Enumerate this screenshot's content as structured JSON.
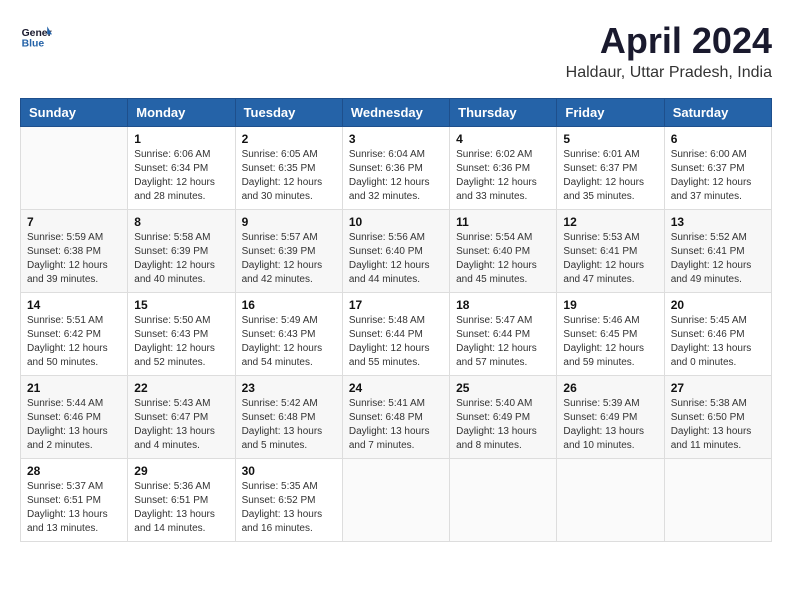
{
  "logo": {
    "line1": "General",
    "line2": "Blue"
  },
  "title": "April 2024",
  "location": "Haldaur, Uttar Pradesh, India",
  "headers": [
    "Sunday",
    "Monday",
    "Tuesday",
    "Wednesday",
    "Thursday",
    "Friday",
    "Saturday"
  ],
  "weeks": [
    [
      {
        "day": "",
        "info": ""
      },
      {
        "day": "1",
        "info": "Sunrise: 6:06 AM\nSunset: 6:34 PM\nDaylight: 12 hours\nand 28 minutes."
      },
      {
        "day": "2",
        "info": "Sunrise: 6:05 AM\nSunset: 6:35 PM\nDaylight: 12 hours\nand 30 minutes."
      },
      {
        "day": "3",
        "info": "Sunrise: 6:04 AM\nSunset: 6:36 PM\nDaylight: 12 hours\nand 32 minutes."
      },
      {
        "day": "4",
        "info": "Sunrise: 6:02 AM\nSunset: 6:36 PM\nDaylight: 12 hours\nand 33 minutes."
      },
      {
        "day": "5",
        "info": "Sunrise: 6:01 AM\nSunset: 6:37 PM\nDaylight: 12 hours\nand 35 minutes."
      },
      {
        "day": "6",
        "info": "Sunrise: 6:00 AM\nSunset: 6:37 PM\nDaylight: 12 hours\nand 37 minutes."
      }
    ],
    [
      {
        "day": "7",
        "info": "Sunrise: 5:59 AM\nSunset: 6:38 PM\nDaylight: 12 hours\nand 39 minutes."
      },
      {
        "day": "8",
        "info": "Sunrise: 5:58 AM\nSunset: 6:39 PM\nDaylight: 12 hours\nand 40 minutes."
      },
      {
        "day": "9",
        "info": "Sunrise: 5:57 AM\nSunset: 6:39 PM\nDaylight: 12 hours\nand 42 minutes."
      },
      {
        "day": "10",
        "info": "Sunrise: 5:56 AM\nSunset: 6:40 PM\nDaylight: 12 hours\nand 44 minutes."
      },
      {
        "day": "11",
        "info": "Sunrise: 5:54 AM\nSunset: 6:40 PM\nDaylight: 12 hours\nand 45 minutes."
      },
      {
        "day": "12",
        "info": "Sunrise: 5:53 AM\nSunset: 6:41 PM\nDaylight: 12 hours\nand 47 minutes."
      },
      {
        "day": "13",
        "info": "Sunrise: 5:52 AM\nSunset: 6:41 PM\nDaylight: 12 hours\nand 49 minutes."
      }
    ],
    [
      {
        "day": "14",
        "info": "Sunrise: 5:51 AM\nSunset: 6:42 PM\nDaylight: 12 hours\nand 50 minutes."
      },
      {
        "day": "15",
        "info": "Sunrise: 5:50 AM\nSunset: 6:43 PM\nDaylight: 12 hours\nand 52 minutes."
      },
      {
        "day": "16",
        "info": "Sunrise: 5:49 AM\nSunset: 6:43 PM\nDaylight: 12 hours\nand 54 minutes."
      },
      {
        "day": "17",
        "info": "Sunrise: 5:48 AM\nSunset: 6:44 PM\nDaylight: 12 hours\nand 55 minutes."
      },
      {
        "day": "18",
        "info": "Sunrise: 5:47 AM\nSunset: 6:44 PM\nDaylight: 12 hours\nand 57 minutes."
      },
      {
        "day": "19",
        "info": "Sunrise: 5:46 AM\nSunset: 6:45 PM\nDaylight: 12 hours\nand 59 minutes."
      },
      {
        "day": "20",
        "info": "Sunrise: 5:45 AM\nSunset: 6:46 PM\nDaylight: 13 hours\nand 0 minutes."
      }
    ],
    [
      {
        "day": "21",
        "info": "Sunrise: 5:44 AM\nSunset: 6:46 PM\nDaylight: 13 hours\nand 2 minutes."
      },
      {
        "day": "22",
        "info": "Sunrise: 5:43 AM\nSunset: 6:47 PM\nDaylight: 13 hours\nand 4 minutes."
      },
      {
        "day": "23",
        "info": "Sunrise: 5:42 AM\nSunset: 6:48 PM\nDaylight: 13 hours\nand 5 minutes."
      },
      {
        "day": "24",
        "info": "Sunrise: 5:41 AM\nSunset: 6:48 PM\nDaylight: 13 hours\nand 7 minutes."
      },
      {
        "day": "25",
        "info": "Sunrise: 5:40 AM\nSunset: 6:49 PM\nDaylight: 13 hours\nand 8 minutes."
      },
      {
        "day": "26",
        "info": "Sunrise: 5:39 AM\nSunset: 6:49 PM\nDaylight: 13 hours\nand 10 minutes."
      },
      {
        "day": "27",
        "info": "Sunrise: 5:38 AM\nSunset: 6:50 PM\nDaylight: 13 hours\nand 11 minutes."
      }
    ],
    [
      {
        "day": "28",
        "info": "Sunrise: 5:37 AM\nSunset: 6:51 PM\nDaylight: 13 hours\nand 13 minutes."
      },
      {
        "day": "29",
        "info": "Sunrise: 5:36 AM\nSunset: 6:51 PM\nDaylight: 13 hours\nand 14 minutes."
      },
      {
        "day": "30",
        "info": "Sunrise: 5:35 AM\nSunset: 6:52 PM\nDaylight: 13 hours\nand 16 minutes."
      },
      {
        "day": "",
        "info": ""
      },
      {
        "day": "",
        "info": ""
      },
      {
        "day": "",
        "info": ""
      },
      {
        "day": "",
        "info": ""
      }
    ]
  ]
}
